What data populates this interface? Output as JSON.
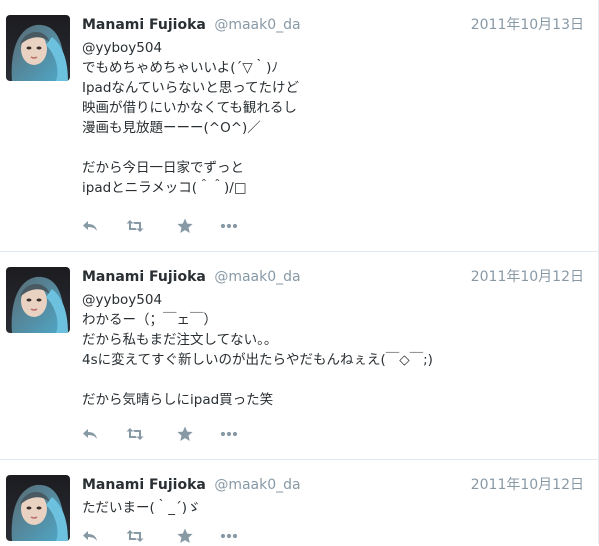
{
  "tweets": [
    {
      "name": "Manami Fujioka",
      "handle": "@maak0_da",
      "date": "2011年10月13日",
      "text": "@yyboy504\nでもめちゃめちゃいいよ(´▽｀)ﾉ\nIpadなんていらないと思ってたけど\n映画が借りにいかなくても観れるし\n漫画も見放題ーーー(^O^)／\n\nだから今日一日家でずっと\nipadとニラメッコ(＾＾)/□"
    },
    {
      "name": "Manami Fujioka",
      "handle": "@maak0_da",
      "date": "2011年10月12日",
      "text": "@yyboy504\nわかるー（；￣ェ￣）\nだから私もまだ注文してない。。\n4sに変えてすぐ新しいのが出たらやだもんねぇえ(￣◇￣;)\n\nだから気晴らしにipad買った笑"
    },
    {
      "name": "Manami Fujioka",
      "handle": "@maak0_da",
      "date": "2011年10月12日",
      "text": "ただいまー(｀_´)ゞ"
    }
  ],
  "icons": {
    "reply": "reply-icon",
    "retweet": "retweet-icon",
    "favorite": "star-icon",
    "more": "more-icon"
  },
  "colors": {
    "name": "#292f33",
    "meta": "#8899a6",
    "icon": "#8899a6",
    "divider": "#e1e8ed"
  }
}
